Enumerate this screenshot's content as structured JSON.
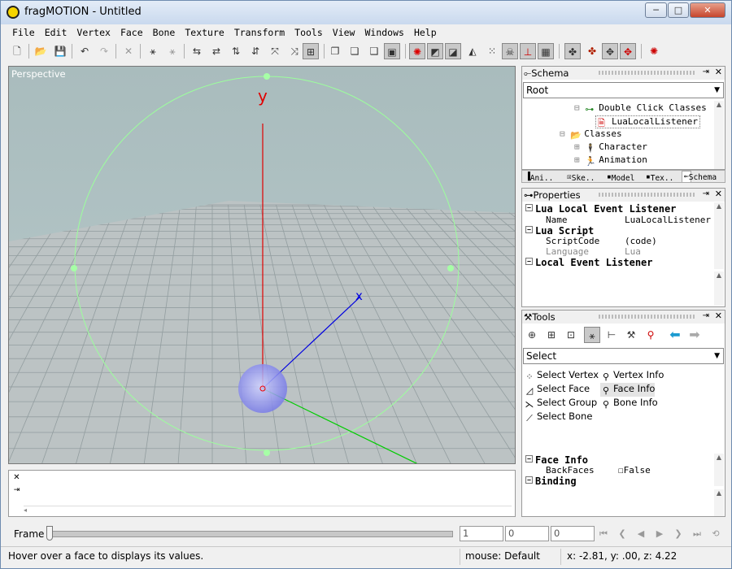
{
  "window": {
    "title": "fragMOTION - Untitled",
    "minimize": "─",
    "maximize": "□",
    "close": "✕"
  },
  "menu": [
    "File",
    "Edit",
    "Vertex",
    "Face",
    "Bone",
    "Texture",
    "Transform",
    "Tools",
    "View",
    "Windows",
    "Help"
  ],
  "viewport": {
    "label": "Perspective",
    "axis_y_label": "y",
    "axis_x_label": "x"
  },
  "schema_panel": {
    "title": "Schema",
    "dropdown": "Root",
    "tree": [
      {
        "label": "Double Click Classes",
        "icon": "link-node-icon"
      },
      {
        "label": "LuaLocalListener",
        "icon": "lua-script-icon"
      },
      {
        "label": "Classes",
        "icon": "folder-open-icon"
      },
      {
        "label": "Character",
        "icon": "character-icon"
      },
      {
        "label": "Animation",
        "icon": "animation-icon"
      }
    ],
    "tabs": [
      "Ani..",
      "Ske..",
      "Model",
      "Tex..",
      "Schema"
    ]
  },
  "properties_panel": {
    "title": "Properties",
    "rows": [
      {
        "type": "category",
        "label": "Lua Local Event Listener"
      },
      {
        "type": "prop",
        "key": "Name",
        "value": "LuaLocalListener"
      },
      {
        "type": "category",
        "label": "Lua Script"
      },
      {
        "type": "prop",
        "key": "ScriptCode",
        "value": "(code)"
      },
      {
        "type": "prop",
        "key": "Language",
        "value": "Lua"
      },
      {
        "type": "category",
        "label": "Local Event Listener"
      }
    ]
  },
  "tools_panel": {
    "title": "Tools",
    "dropdown": "Select",
    "items": [
      {
        "label": "Select Vertex",
        "icon": "select-vertex-icon"
      },
      {
        "label": "Vertex Info",
        "icon": "vertex-info-icon"
      },
      {
        "label": "Select Face",
        "icon": "select-face-icon"
      },
      {
        "label": "Face Info",
        "icon": "face-info-icon"
      },
      {
        "label": "Select Group",
        "icon": "select-group-icon"
      },
      {
        "label": "Bone Info",
        "icon": "bone-info-icon"
      },
      {
        "label": "Select Bone",
        "icon": "select-bone-icon"
      }
    ],
    "info_rows": [
      {
        "type": "category",
        "label": "Face Info"
      },
      {
        "type": "prop",
        "key": "BackFaces",
        "value": "False"
      },
      {
        "type": "category",
        "label": "Binding"
      }
    ]
  },
  "framebar": {
    "label": "Frame",
    "field1": "1",
    "field2": "0",
    "field3": "0"
  },
  "status": {
    "message": "Hover over a face to displays its values.",
    "mouse": "mouse: Default",
    "coords": "x: -2.81, y: .00, z: 4.22"
  },
  "colors": {
    "viewport_bg": "#b4c4c6",
    "grid": "#8f9da0",
    "y_axis": "#e00000",
    "x_axis": "#0000e0",
    "z_axis": "#00cc00",
    "gizmo": "#aaffaa",
    "bone_sphere": "#8a8cf0"
  }
}
